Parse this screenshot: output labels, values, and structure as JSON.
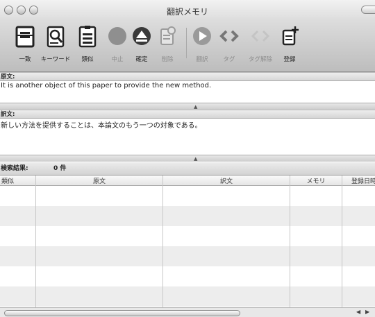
{
  "window": {
    "title": "翻訳メモリ"
  },
  "toolbar": {
    "items": [
      {
        "label": "一致",
        "icon": "document-list-icon",
        "enabled": true
      },
      {
        "label": "キーワード",
        "icon": "document-magnifier-icon",
        "enabled": true
      },
      {
        "label": "類似",
        "icon": "document-compare-icon",
        "enabled": true
      },
      {
        "label": "中止",
        "icon": "stop-icon",
        "enabled": false
      },
      {
        "label": "確定",
        "icon": "eject-icon",
        "enabled": true
      },
      {
        "label": "削除",
        "icon": "delete-record-icon",
        "enabled": false
      },
      {
        "label": "翻訳",
        "icon": "play-icon",
        "enabled": false
      },
      {
        "label": "タグ",
        "icon": "tag-brackets-icon",
        "enabled": false
      },
      {
        "label": "タグ解除",
        "icon": "untag-brackets-icon",
        "enabled": false
      },
      {
        "label": "登録",
        "icon": "add-record-icon",
        "enabled": true
      }
    ]
  },
  "source": {
    "label": "原文:",
    "text": "It is another object of this paper to provide the new method."
  },
  "translation": {
    "label": "訳文:",
    "text": "新しい方法を提供することは、本論文のもう一つの対象である。"
  },
  "search": {
    "label": "検索結果:",
    "count": "0 件"
  },
  "table": {
    "columns": [
      "類似",
      "原文",
      "訳文",
      "メモリ",
      "登録日時"
    ],
    "rows": []
  }
}
